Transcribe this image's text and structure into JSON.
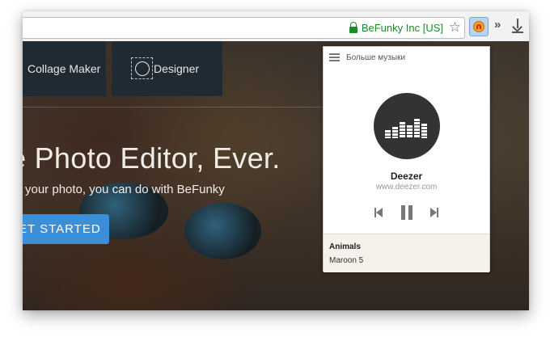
{
  "browser": {
    "site_identity": "BeFunky Inc [US]",
    "extension_icon": "music-player-extension-icon",
    "overflow_label": "»"
  },
  "page": {
    "nav": {
      "collage_label": "Collage Maker",
      "designer_label": "Designer"
    },
    "headline": "e Photo Editor, Ever.",
    "subline": "your photo, you can do with BeFunky",
    "cta_label": "ET STARTED"
  },
  "popup": {
    "menu_label": "Больше музыки",
    "service_name": "Deezer",
    "service_url": "www.deezer.com",
    "now_playing": {
      "track": "Animals",
      "artist": "Maroon 5"
    }
  },
  "colors": {
    "secure_green": "#1e8a2c",
    "cta_blue": "#3b8fd9",
    "nav_tile": "#202a33",
    "deezer_logo_bg": "#333333"
  }
}
